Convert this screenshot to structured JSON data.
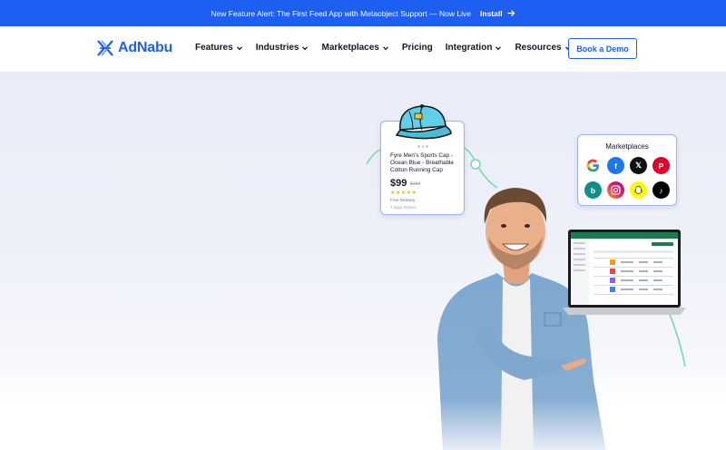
{
  "announcement": {
    "message": "New Feature Alert: The First Feed App with Metaobject Support — Now Live",
    "cta_label": "Install"
  },
  "header": {
    "logo_text": "AdNabu",
    "nav": [
      {
        "label": "Features",
        "dropdown": true
      },
      {
        "label": "Industries",
        "dropdown": true
      },
      {
        "label": "Marketplaces",
        "dropdown": true
      },
      {
        "label": "Pricing",
        "dropdown": false
      },
      {
        "label": "Integration",
        "dropdown": true
      },
      {
        "label": "Resources",
        "dropdown": true
      }
    ],
    "cta_label": "Book a Demo"
  },
  "product_card": {
    "title": "Fyre Men's Sports Cap - Ocean Blue - Breathable Cotton Running Cap",
    "price": "$99",
    "old_price": "$160",
    "rating_stars": 5,
    "delivery": "Free Delivery",
    "days": "7 days Return"
  },
  "marketplaces_card": {
    "title": "Marketplaces",
    "icons": [
      "google-icon",
      "facebook-icon",
      "x-icon",
      "pinterest-icon",
      "bing-icon",
      "instagram-icon",
      "snapchat-icon",
      "tiktok-icon"
    ]
  },
  "colors": {
    "brand": "#1d5ff0",
    "card_border": "#9bb6ee",
    "curve": "#7dd8a8",
    "laptop_accent": "#1e7a4f"
  }
}
